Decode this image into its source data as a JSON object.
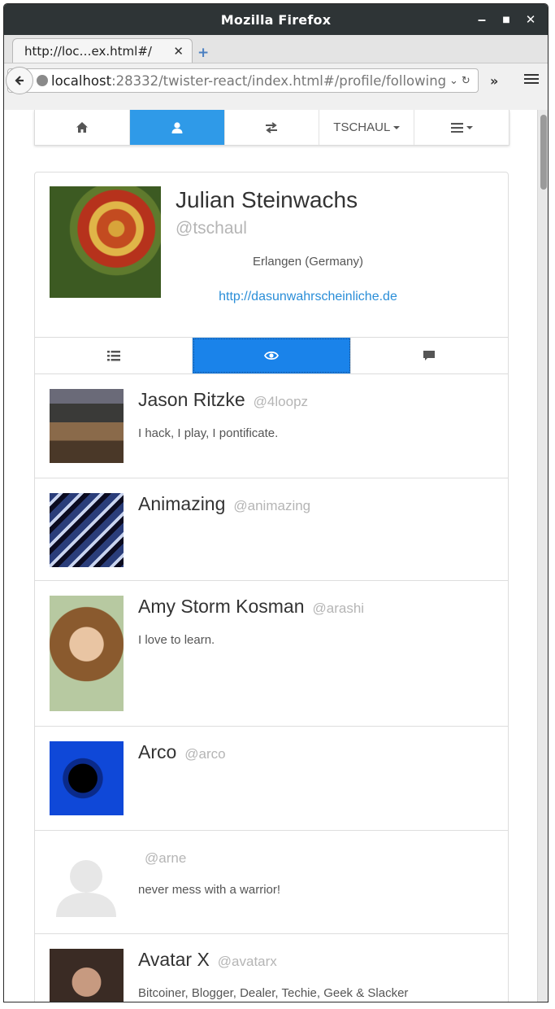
{
  "window": {
    "title": "Mozilla Firefox",
    "minimize": "‒",
    "maximize": "■",
    "close": "✕"
  },
  "tab": {
    "title": "http://loc…ex.html#/",
    "close": "✕",
    "new_tab": "+"
  },
  "urlbar": {
    "host": "localhost",
    "rest": ":28332/twister-react/index.html#/profile/following",
    "dropdown": "⌄",
    "reload": "↻"
  },
  "toolbar": {
    "overflow": "»"
  },
  "appnav": {
    "account_label": "TSCHAUL"
  },
  "profile": {
    "name": "Julian Steinwachs",
    "handle": "@tschaul",
    "location": "Erlangen (Germany)",
    "url": "http://dasunwahrscheinliche.de"
  },
  "users": [
    {
      "name": "Jason Ritzke",
      "handle": "@4loopz",
      "bio": "I hack, I play, I pontificate.",
      "avatar": "photo"
    },
    {
      "name": "Animazing",
      "handle": "@animazing",
      "bio": "",
      "avatar": "animazing-logo"
    },
    {
      "name": "Amy Storm Kosman",
      "handle": "@arashi",
      "bio": "I love to learn.",
      "avatar": "photo"
    },
    {
      "name": "Arco",
      "handle": "@arco",
      "bio": "",
      "avatar": "mandelbrot"
    },
    {
      "name": "",
      "handle": "@arne",
      "bio": "never mess with a warrior!",
      "avatar": "default-silhouette"
    },
    {
      "name": "Avatar X",
      "handle": "@avatarx",
      "bio": "Bitcoiner, Blogger, Dealer, Techie, Geek & Slacker",
      "avatar": "photo"
    }
  ],
  "colors": {
    "accent": "#2f9ae8",
    "active_subtab": "#1a83ea",
    "link": "#2a8ed8",
    "muted": "#b5b5b5"
  }
}
